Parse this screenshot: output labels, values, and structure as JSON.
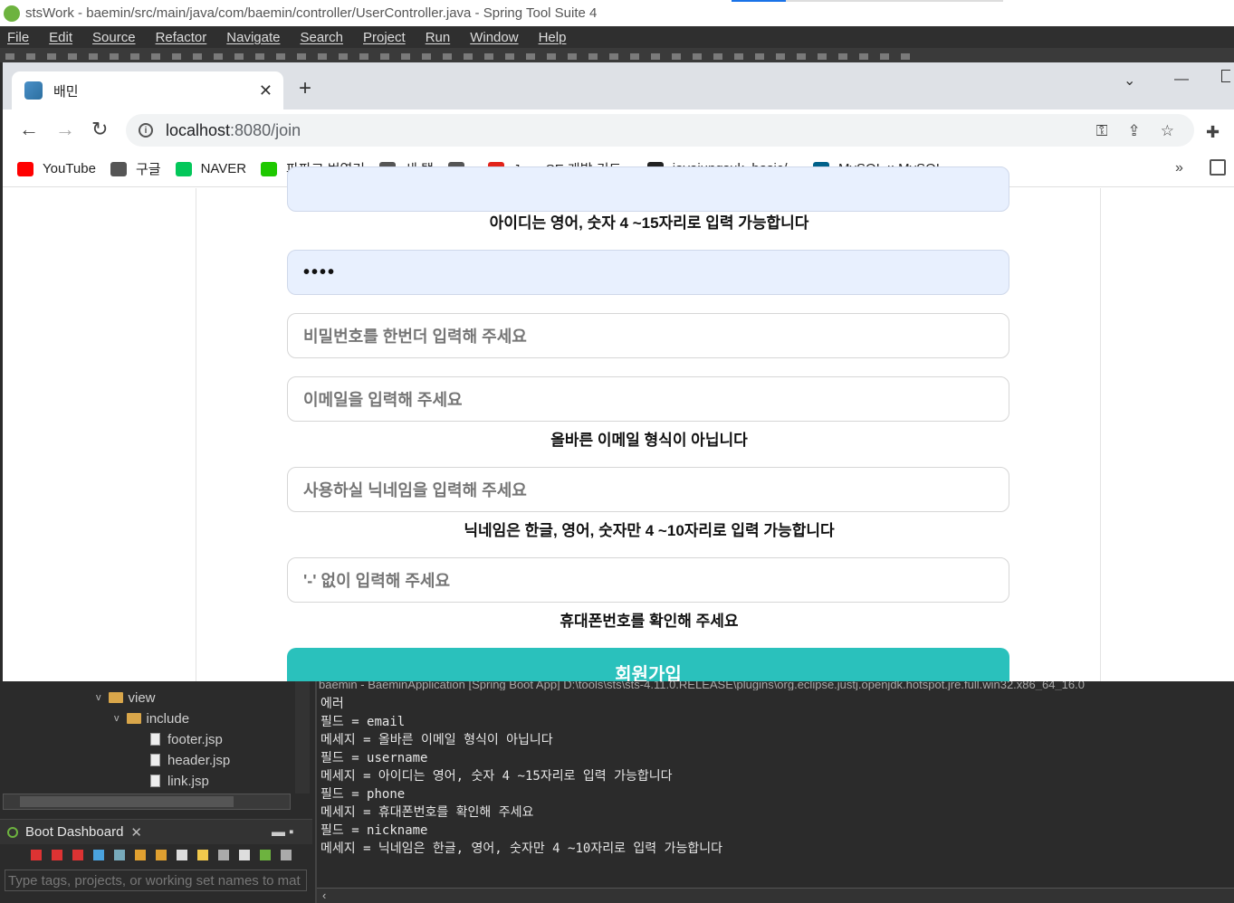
{
  "ide": {
    "title": "stsWork - baemin/src/main/java/com/baemin/controller/UserController.java - Spring Tool Suite 4",
    "menu": [
      "File",
      "Edit",
      "Source",
      "Refactor",
      "Navigate",
      "Search",
      "Project",
      "Run",
      "Window",
      "Help"
    ]
  },
  "browser": {
    "tab_title": "배민",
    "url_host": "localhost",
    "url_rest": ":8080/join",
    "bookmarks": [
      {
        "label": "YouTube",
        "color": "#ff0000"
      },
      {
        "label": "구글",
        "color": "#555555"
      },
      {
        "label": "NAVER",
        "color": "#03c75a"
      },
      {
        "label": "파파고 번역기",
        "color": "#1ec800"
      },
      {
        "label": "새 탭",
        "color": "#555555"
      },
      {
        "label": "",
        "color": "#555555"
      },
      {
        "label": "Java SE 개발 키트...",
        "color": "#e2231a"
      },
      {
        "label": "javajungsuk_basic/...",
        "color": "#222222"
      },
      {
        "label": "MySQL :: MySQL...",
        "color": "#00618a"
      }
    ],
    "more": "»"
  },
  "form": {
    "id_msg": "아이디는 영어, 숫자 4 ~15자리로 입력 가능합니다",
    "password_value": "••••",
    "password_confirm_placeholder": "비밀번호를 한번더 입력해 주세요",
    "email_placeholder": "이메일을 입력해 주세요",
    "email_msg": "올바른 이메일 형식이 아닙니다",
    "nickname_placeholder": "사용하실 닉네임을 입력해 주세요",
    "nickname_msg": "닉네임은 한글, 영어, 숫자만 4 ~10자리로 입력 가능합니다",
    "phone_placeholder": "'-' 없이 입력해 주세요",
    "phone_msg": "휴대폰번호를 확인해 주세요",
    "join_button": "회원가입",
    "accent": "#2ac1bc"
  },
  "explorer": {
    "tree": [
      "view",
      "include",
      "footer.jsp",
      "header.jsp",
      "link.jsp"
    ],
    "boot_dashboard": "Boot Dashboard",
    "filter_placeholder": "Type tags, projects, or working set names to mat"
  },
  "console": {
    "header": "baemin - BaeminApplication [Spring Boot App] D:\\tools\\sts\\sts-4.11.0.RELEASE\\plugins\\org.eclipse.justj.openjdk.hotspot.jre.full.win32.x86_64_16.0",
    "lines": [
      "에러",
      "필드 = email",
      "메세지 = 올바른 이메일 형식이 아닙니다",
      "필드 = username",
      "메세지 = 아이디는 영어, 숫자 4 ~15자리로 입력 가능합니다",
      "필드 = phone",
      "메세지 = 휴대폰번호를 확인해 주세요",
      "필드 = nickname",
      "메세지 = 닉네임은 한글, 영어, 숫자만 4 ~10자리로 입력 가능합니다"
    ]
  }
}
